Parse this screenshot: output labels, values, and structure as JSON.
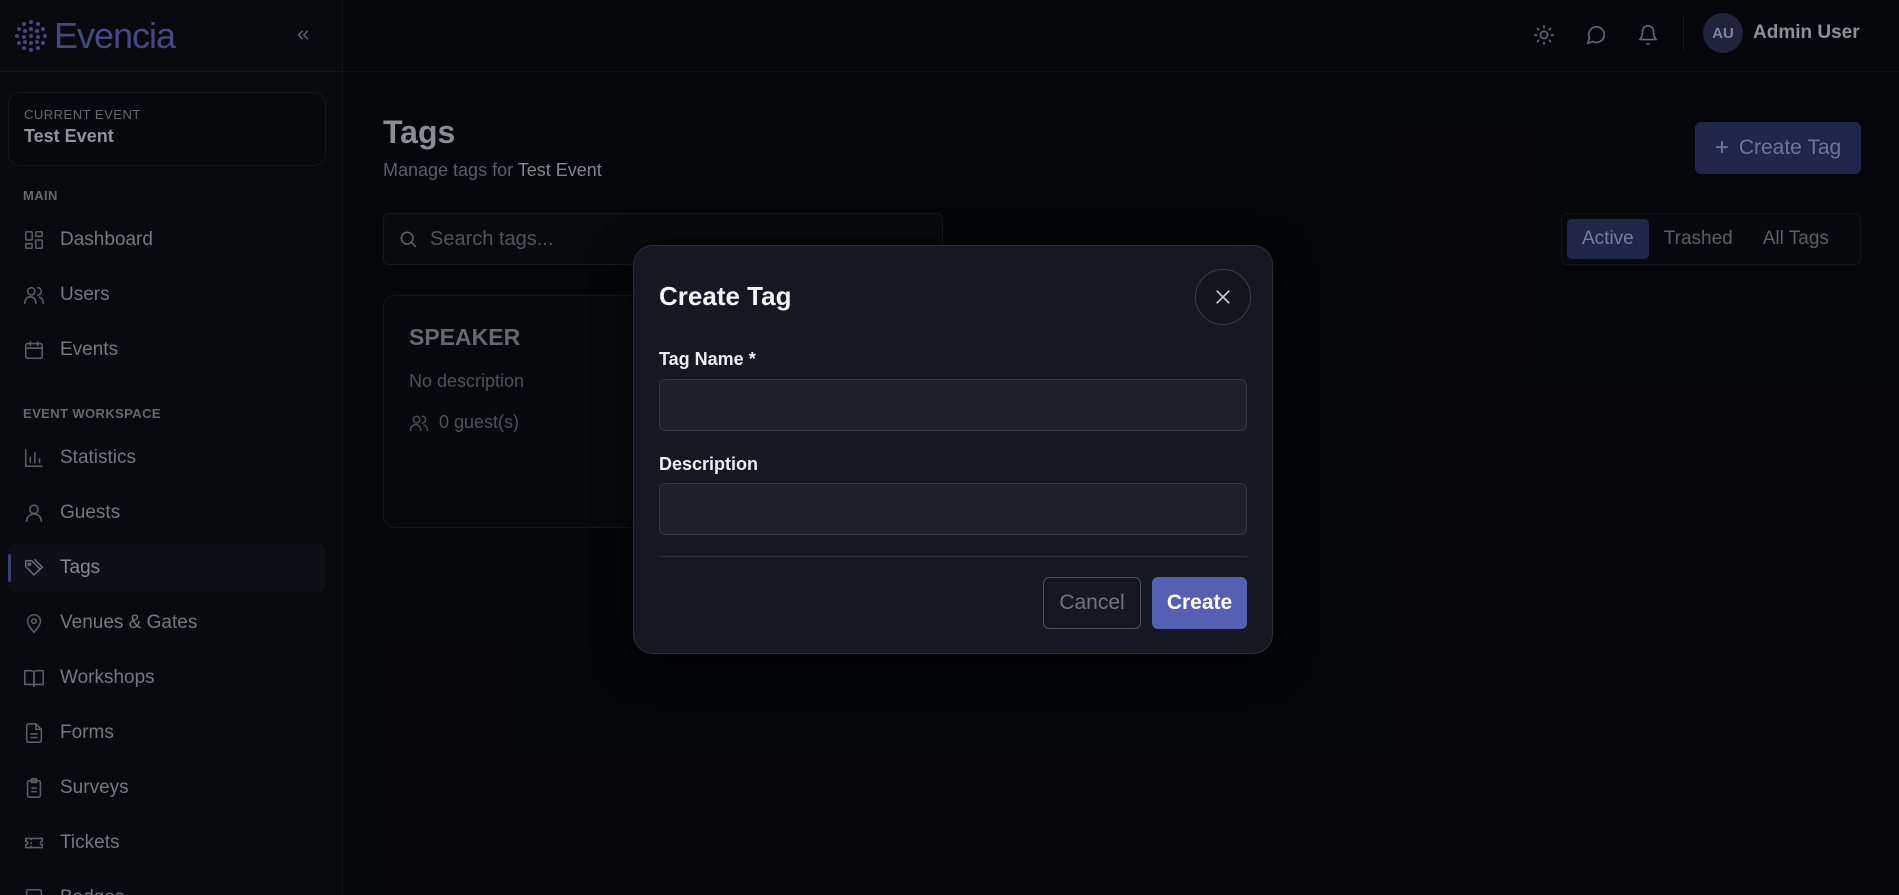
{
  "app": {
    "brand": "Evencia"
  },
  "current_event": {
    "label": "CURRENT EVENT",
    "name": "Test Event"
  },
  "sidebar": {
    "sections": [
      {
        "label": "MAIN",
        "items": [
          "Dashboard",
          "Users",
          "Events"
        ]
      },
      {
        "label": "EVENT WORKSPACE",
        "items": [
          "Statistics",
          "Guests",
          "Tags",
          "Venues & Gates",
          "Workshops",
          "Forms",
          "Surveys",
          "Tickets",
          "Badges"
        ]
      }
    ],
    "active_item": "Tags"
  },
  "topbar": {
    "user_initials": "AU",
    "user_name": "Admin User"
  },
  "page": {
    "title": "Tags",
    "subtitle_prefix": "Manage tags for",
    "subtitle_event": "Test Event",
    "create_button": "Create Tag",
    "search_placeholder": "Search tags...",
    "filter_tabs": [
      "Active",
      "Trashed",
      "All Tags"
    ],
    "active_filter": "Active"
  },
  "tag_card": {
    "name": "SPEAKER",
    "description": "No description",
    "guests": "0 guest(s)"
  },
  "modal": {
    "title": "Create Tag",
    "name_label": "Tag Name *",
    "name_value": "",
    "description_label": "Description",
    "description_value": "",
    "cancel_label": "Cancel",
    "create_label": "Create"
  },
  "colors": {
    "accent": "#5560b3",
    "background": "#08090d",
    "modal_bg": "#161821"
  }
}
